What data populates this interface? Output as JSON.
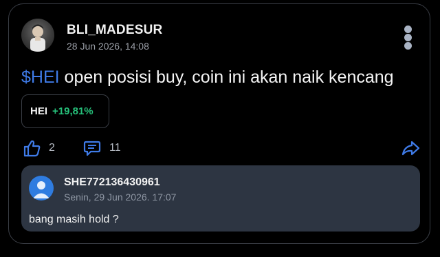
{
  "post": {
    "username": "BLI_MADESUR",
    "timestamp": "28 Jun 2026, 14:08",
    "ticker": "$HEI",
    "text": " open posisi buy, coin ini akan naik kencang",
    "coin": {
      "symbol": "HEI",
      "change": "+19,81%",
      "change_color": "#26c07a"
    },
    "likes": "2",
    "comments": "11",
    "icons": {
      "more": "more-vertical-icon",
      "like": "thumbs-up-icon",
      "comment": "comment-icon",
      "share": "share-icon"
    }
  },
  "reply": {
    "username": "SHE772136430961",
    "timestamp": "Senin, 29 Jun 2026. 17:07",
    "text": "bang masih hold ?"
  },
  "colors": {
    "accent": "#3f7be8",
    "positive": "#26c07a",
    "reply_bg": "#2d3542"
  }
}
